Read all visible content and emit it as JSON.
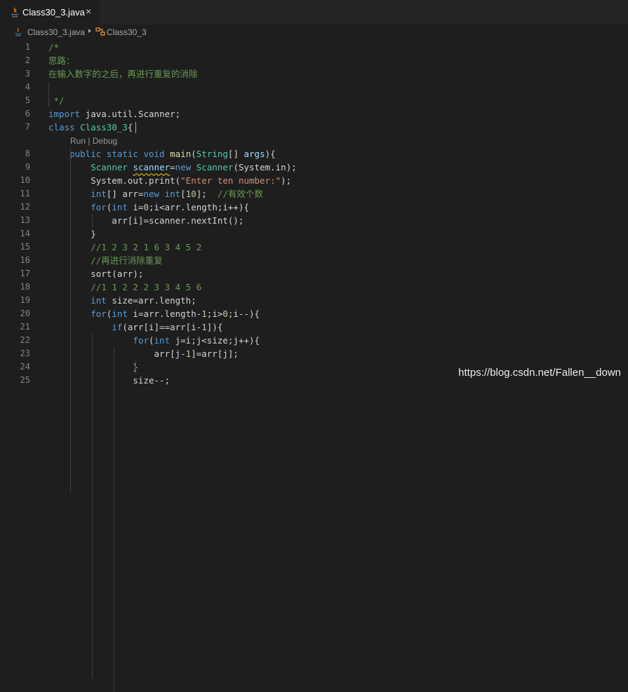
{
  "tab": {
    "title": "Class30_3.java",
    "close_icon": "×"
  },
  "breadcrumb": {
    "file": "Class30_3.java",
    "symbol": "Class30_3"
  },
  "codelens": {
    "run": "Run",
    "separator": " | ",
    "debug": "Debug"
  },
  "lines": [
    {
      "n": "1",
      "tokens": [
        [
          "cm",
          "/*"
        ]
      ]
    },
    {
      "n": "2",
      "tokens": [
        [
          "cm",
          "思路："
        ]
      ]
    },
    {
      "n": "3",
      "tokens": [
        [
          "cm",
          "在输入数字的之后，再进行重复的消除"
        ]
      ]
    },
    {
      "n": "4",
      "tokens": [
        [
          "cm",
          " "
        ]
      ]
    },
    {
      "n": "5",
      "tokens": [
        [
          "cm",
          " */"
        ]
      ]
    },
    {
      "n": "6",
      "tokens": [
        [
          "kw",
          "import"
        ],
        [
          "p",
          " java.util.Scanner;"
        ]
      ]
    },
    {
      "n": "7",
      "tokens": [
        [
          "kw",
          "class"
        ],
        [
          "p",
          " "
        ],
        [
          "ty",
          "Class30_3"
        ],
        [
          "p",
          "{"
        ]
      ]
    },
    {
      "n": "8",
      "tokens": [
        [
          "p",
          "    "
        ],
        [
          "kw",
          "public"
        ],
        [
          "p",
          " "
        ],
        [
          "kw",
          "static"
        ],
        [
          "p",
          " "
        ],
        [
          "kw",
          "void"
        ],
        [
          "p",
          " "
        ],
        [
          "fn",
          "main"
        ],
        [
          "p",
          "("
        ],
        [
          "ty",
          "String"
        ],
        [
          "p",
          "[] "
        ],
        [
          "var",
          "args"
        ],
        [
          "p",
          "){"
        ]
      ]
    },
    {
      "n": "9",
      "tokens": [
        [
          "p",
          "        "
        ],
        [
          "ty",
          "Scanner"
        ],
        [
          "p",
          " "
        ],
        [
          "sq",
          "scanner"
        ],
        [
          "p",
          "="
        ],
        [
          "kw",
          "new"
        ],
        [
          "p",
          " "
        ],
        [
          "ty",
          "Scanner"
        ],
        [
          "p",
          "(System.in);"
        ]
      ]
    },
    {
      "n": "10",
      "tokens": [
        [
          "p",
          "        System.out.print("
        ],
        [
          "str",
          "\"Enter ten number:\""
        ],
        [
          "p",
          ");"
        ]
      ]
    },
    {
      "n": "11",
      "tokens": [
        [
          "p",
          "        "
        ],
        [
          "kw",
          "int"
        ],
        [
          "p",
          "[] arr="
        ],
        [
          "kw",
          "new"
        ],
        [
          "p",
          " "
        ],
        [
          "kw",
          "int"
        ],
        [
          "p",
          "["
        ],
        [
          "num",
          "10"
        ],
        [
          "p",
          "];  "
        ],
        [
          "cm",
          "//有效个数"
        ]
      ]
    },
    {
      "n": "12",
      "tokens": [
        [
          "p",
          "        "
        ],
        [
          "kw",
          "for"
        ],
        [
          "p",
          "("
        ],
        [
          "kw",
          "int"
        ],
        [
          "p",
          " i="
        ],
        [
          "num",
          "0"
        ],
        [
          "p",
          ";i<arr.length;i++){"
        ]
      ]
    },
    {
      "n": "13",
      "tokens": [
        [
          "p",
          "            arr[i]=scanner.nextInt();"
        ]
      ]
    },
    {
      "n": "14",
      "tokens": [
        [
          "p",
          "        }"
        ]
      ]
    },
    {
      "n": "15",
      "tokens": [
        [
          "p",
          "        "
        ],
        [
          "cm",
          "//1 2 3 2 1 6 3 4 5 2"
        ]
      ]
    },
    {
      "n": "16",
      "tokens": [
        [
          "p",
          "        "
        ],
        [
          "cm",
          "//再进行消除重复"
        ]
      ]
    },
    {
      "n": "17",
      "tokens": [
        [
          "p",
          "        sort(arr);"
        ]
      ]
    },
    {
      "n": "18",
      "tokens": [
        [
          "p",
          "        "
        ],
        [
          "cm",
          "//1 1 2 2 2 3 3 4 5 6"
        ]
      ]
    },
    {
      "n": "19",
      "tokens": [
        [
          "p",
          "        "
        ],
        [
          "kw",
          "int"
        ],
        [
          "p",
          " size=arr.length;"
        ]
      ]
    },
    {
      "n": "20",
      "tokens": [
        [
          "p",
          "        "
        ],
        [
          "kw",
          "for"
        ],
        [
          "p",
          "("
        ],
        [
          "kw",
          "int"
        ],
        [
          "p",
          " i=arr.length-"
        ],
        [
          "num",
          "1"
        ],
        [
          "p",
          ";i>"
        ],
        [
          "num",
          "0"
        ],
        [
          "p",
          ";i--){"
        ]
      ]
    },
    {
      "n": "21",
      "tokens": [
        [
          "p",
          "            "
        ],
        [
          "kw",
          "if"
        ],
        [
          "p",
          "(arr[i]==arr[i-"
        ],
        [
          "num",
          "1"
        ],
        [
          "p",
          "]){"
        ]
      ]
    },
    {
      "n": "22",
      "tokens": [
        [
          "p",
          "                "
        ],
        [
          "kw",
          "for"
        ],
        [
          "p",
          "("
        ],
        [
          "kw",
          "int"
        ],
        [
          "p",
          " j=i;j<size;j++){"
        ]
      ]
    },
    {
      "n": "23",
      "tokens": [
        [
          "p",
          "                    arr[j-"
        ],
        [
          "num",
          "1"
        ],
        [
          "p",
          "]=arr[j];"
        ]
      ]
    },
    {
      "n": "24",
      "tokens": [
        [
          "p",
          "                }"
        ]
      ]
    },
    {
      "n": "25",
      "tokens": [
        [
          "p",
          "                size--;"
        ]
      ]
    }
  ],
  "watermark": "https://blog.csdn.net/Fallen__down"
}
